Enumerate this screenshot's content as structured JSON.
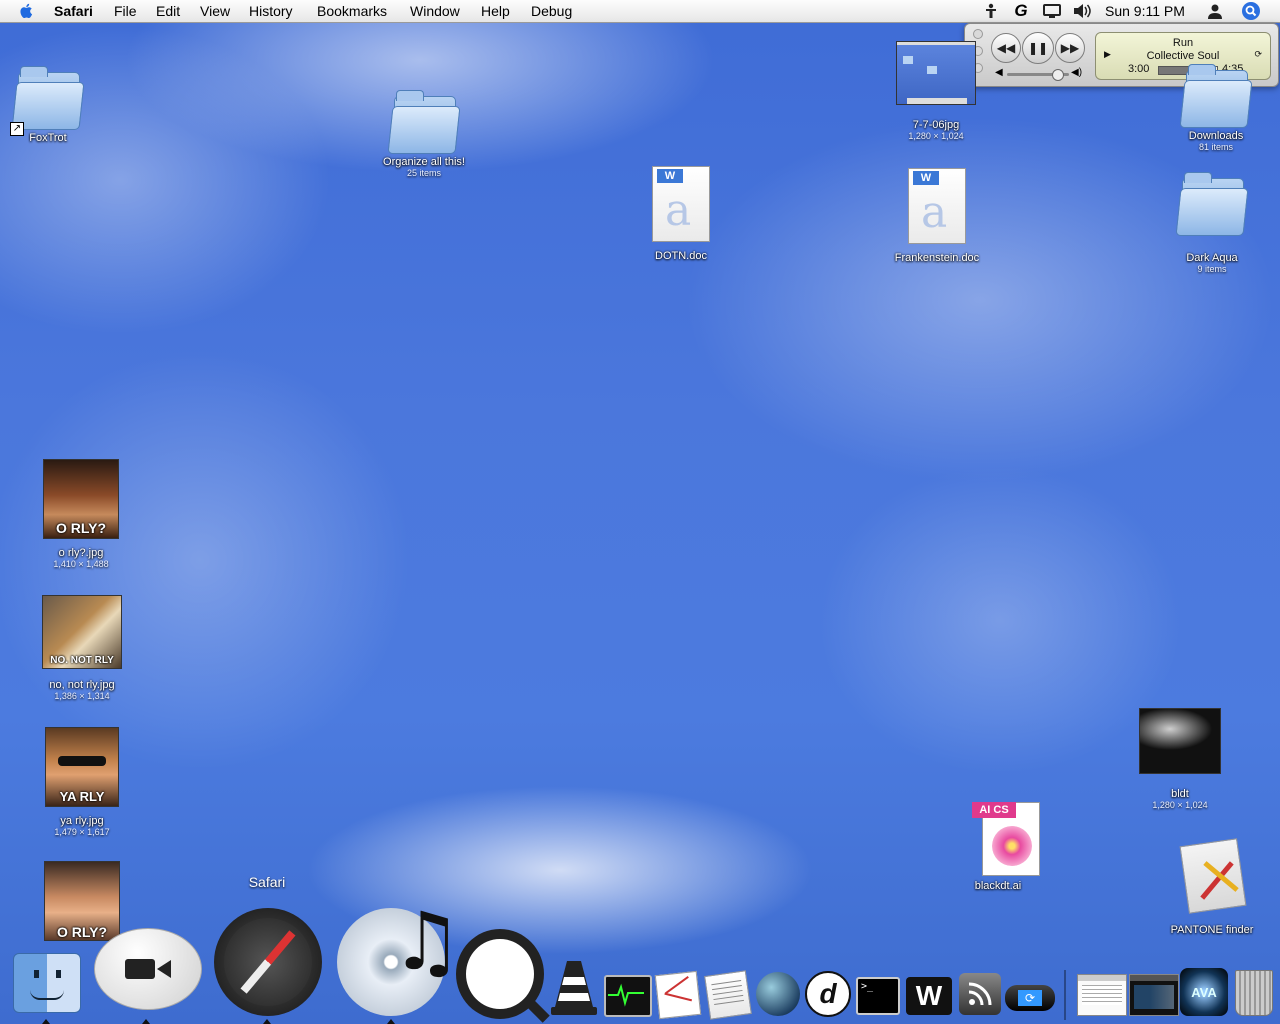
{
  "menubar": {
    "app": "Safari",
    "items": [
      "File",
      "Edit",
      "View",
      "History",
      "Bookmarks",
      "Window",
      "Help",
      "Debug"
    ],
    "clock": "Sun 9:11 PM",
    "status_icons": [
      "accessibility-icon",
      "growl-icon",
      "display-icon",
      "volume-icon"
    ]
  },
  "itunes": {
    "track": "Run",
    "artist": "Collective Soul",
    "elapsed": "3:00",
    "total": "4:35",
    "progress": 0.65,
    "volume": 0.8
  },
  "desktop_icons": [
    {
      "name": "FoxTrot",
      "info": ""
    },
    {
      "name": "Organize all this!",
      "info": "25 items"
    },
    {
      "name": "DOTN.doc",
      "info": ""
    },
    {
      "name": "Frankenstein.doc",
      "info": ""
    },
    {
      "name": "7-7-06jpg",
      "info": "1,280 × 1,024"
    },
    {
      "name": "Downloads",
      "info": "81 items"
    },
    {
      "name": "Dark Aqua",
      "info": "9 items"
    },
    {
      "name": "o rly?.jpg",
      "info": "1,410 × 1,488",
      "caption": "O RLY?"
    },
    {
      "name": "no, not rly.jpg",
      "info": "1,386 × 1,314",
      "caption": "NO. NOT RLY"
    },
    {
      "name": "ya rly.jpg",
      "info": "1,479 × 1,617",
      "caption": "YA RLY"
    },
    {
      "name": "bldt",
      "info": "1,280 × 1,024"
    },
    {
      "name": "blackdt.ai",
      "info": "",
      "badge": "AI CS"
    },
    {
      "name": "PANTONE finder",
      "info": ""
    },
    {
      "name": "",
      "info": "",
      "caption": "O RLY?"
    }
  ],
  "dock": {
    "hover_label": "Safari",
    "apps": [
      "Finder",
      "iChat",
      "Safari",
      "iTunes",
      "QuickTime Player",
      "VLC",
      "Activity Monitor",
      "Script Editor",
      "TextEdit",
      "Camino",
      "Dreamweaver",
      "Terminal",
      "Word Processor",
      "RSS",
      "PSP",
      "Window 1",
      "Window 2",
      "Audio Hijack",
      "Trash"
    ]
  },
  "colors": {
    "desktop": "#4b77dc",
    "menubar": "#ededed"
  }
}
